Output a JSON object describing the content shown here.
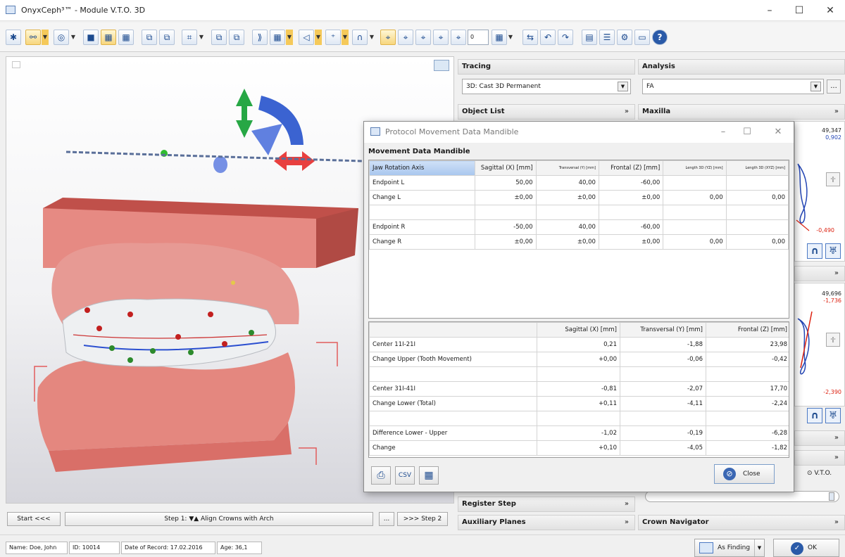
{
  "window": {
    "title": "OnyxCeph³™ - Module V.T.O. 3D",
    "minimize": "–",
    "maximize": "☐",
    "close": "✕"
  },
  "toolbar": {
    "buttons": [
      "✱",
      "⚯",
      "◎",
      "■",
      "▦",
      "▦",
      "⧉",
      "⧉",
      "⌗",
      "⧉",
      "⧉",
      "⟫",
      "▦",
      "◁",
      "⁺",
      "∩",
      "⌖",
      "⌖",
      "⌖",
      "⌖",
      "⌖",
      "▦",
      "⇆",
      "↶",
      "↷",
      "▤",
      "☰",
      "⚙",
      "▭",
      "?"
    ],
    "spin_value": "0"
  },
  "panels": {
    "tracing": {
      "title": "Tracing",
      "value": "3D: Cast 3D Permanent"
    },
    "analysis": {
      "title": "Analysis",
      "value": "FA",
      "more": "..."
    },
    "object_list": {
      "title": "Object List",
      "chevron": "»"
    },
    "maxilla": {
      "title": "Maxilla",
      "chevron": "»",
      "val1": "49,347",
      "val2": "0,902",
      "val3": "-0,490",
      "step_btn": "·|·"
    },
    "mandible": {
      "chevron": "»",
      "val1": "49,696",
      "val2": "-1,736",
      "val3": "-2,390",
      "step_btn": "·|·"
    },
    "collapsed1": {
      "chevron": "»"
    },
    "collapsed2": {
      "chevron": "»"
    },
    "vto": {
      "label": "V.T.O."
    },
    "register_step": {
      "title": "Register Step",
      "chevron": "»"
    },
    "auxiliary_planes": {
      "title": "Auxiliary Planes",
      "chevron": "»"
    },
    "crown_navigator": {
      "title": "Crown Navigator",
      "chevron": "»"
    },
    "arch_icon": "∩",
    "tooth_icon": "♅"
  },
  "stepbar": {
    "start": "Start <<<",
    "step": "Step 1: ▼▲ Align Crowns with Arch",
    "more": "...",
    "next": ">>> Step 2"
  },
  "status": {
    "name": "Name: Doe, John",
    "id": "ID: 10014",
    "date": "Date of Record: 17.02.2016",
    "age": "Age: 36,1",
    "as_finding": "As Finding",
    "ok": "OK"
  },
  "dialog": {
    "title": "Protocol Movement Data Mandible",
    "subtitle": "Movement Data Mandible",
    "top_table": {
      "headers": [
        "Jaw Rotation Axis",
        "Sagittal (X) [mm]",
        "Transversal (Y) [mm]",
        "Frontal (Z) [mm]",
        "Length 3D (YZ) [mm]",
        "Length 3D (XYZ) [mm]"
      ],
      "rows": [
        [
          "Endpoint L",
          "50,00",
          "40,00",
          "-60,00",
          "",
          ""
        ],
        [
          "Change L",
          "±0,00",
          "±0,00",
          "±0,00",
          "0,00",
          "0,00"
        ],
        [
          "",
          "",
          "",
          "",
          "",
          ""
        ],
        [
          "Endpoint R",
          "-50,00",
          "40,00",
          "-60,00",
          "",
          ""
        ],
        [
          "Change R",
          "±0,00",
          "±0,00",
          "±0,00",
          "0,00",
          "0,00"
        ]
      ]
    },
    "bottom_table": {
      "headers": [
        "",
        "Sagittal (X) [mm]",
        "Transversal (Y) [mm]",
        "Frontal (Z) [mm]"
      ],
      "rows": [
        [
          "Center 11I-21I",
          "0,21",
          "-1,88",
          "23,98"
        ],
        [
          "Change Upper (Tooth Movement)",
          "+0,00",
          "-0,06",
          "-0,42"
        ],
        [
          "",
          "",
          "",
          ""
        ],
        [
          "Center 31I-41I",
          "-0,81",
          "-2,07",
          "17,70"
        ],
        [
          "Change Lower (Total)",
          "+0,11",
          "-4,11",
          "-2,24"
        ],
        [
          "",
          "",
          "",
          ""
        ],
        [
          "Difference Lower - Upper",
          "-1,02",
          "-0,19",
          "-6,28"
        ],
        [
          "Change",
          "+0,10",
          "-4,05",
          "-1,82"
        ]
      ]
    },
    "print_icon": "⎙",
    "csv_label": "CSV",
    "grid_icon": "▦",
    "close_label": "Close",
    "close_icon": "⊘"
  }
}
